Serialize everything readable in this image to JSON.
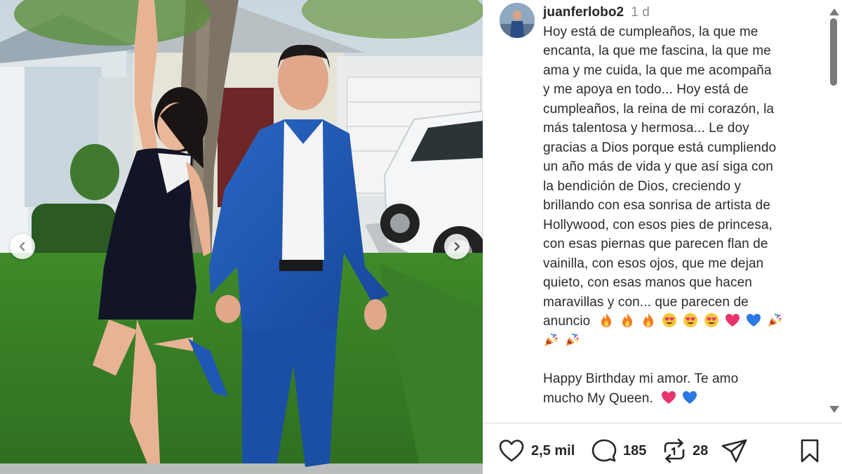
{
  "post": {
    "username": "juanferlobo2",
    "time": "1 d",
    "caption_lines": [
      "Hoy está de cumpleaños, la que me",
      "encanta, la que me fascina, la que me",
      "ama y me cuida, la que me acompaña",
      "y me apoya en todo... Hoy está de",
      "cumpleaños, la reina de mi corazón, la",
      "más talentosa y hermosa... Le doy",
      "gracias a Dios porque está cumpliendo",
      "un año más de vida y que así siga con",
      "la bendición de Dios, creciendo y",
      "brillando con esa sonrisa de artista de",
      "Hollywood, con esos pies de princesa,",
      "con esas piernas que parecen flan de",
      "vainilla, con esos ojos, que me dejan",
      "quieto, con esas manos que hacen",
      "maravillas y con... que parecen de"
    ],
    "caption_last_word": "anuncio",
    "emoji_line_1": [
      "fire-emoji",
      "fire-emoji",
      "fire-emoji",
      "heart-eyes-emoji",
      "heart-eyes-emoji",
      "heart-eyes-emoji",
      "pink-heart-emoji",
      "blue-heart-emoji",
      "party-popper-emoji"
    ],
    "emoji_line_2": [
      "party-popper-emoji",
      "party-popper-emoji"
    ],
    "english_line_1": "Happy Birthday mi amor. Te amo",
    "english_line_2": "mucho My Queen.",
    "english_emojis": [
      "pink-heart-emoji",
      "blue-heart-emoji"
    ]
  },
  "actions": {
    "likes": "2,5 mil",
    "comments": "185",
    "reposts": "28"
  },
  "icons": {
    "like": "heart-outline-icon",
    "comment": "speech-bubble-icon",
    "repost": "repost-arrows-icon",
    "share": "paper-plane-icon",
    "save": "bookmark-icon",
    "prev": "chevron-left-icon",
    "next": "chevron-right-icon"
  },
  "colors": {
    "text": "#262626",
    "muted": "#8e8e8e",
    "divider": "#dbdbdb",
    "suit_blue": "#1f57b5",
    "heart_pink": "#e8336b",
    "heart_blue": "#2a78e4"
  }
}
